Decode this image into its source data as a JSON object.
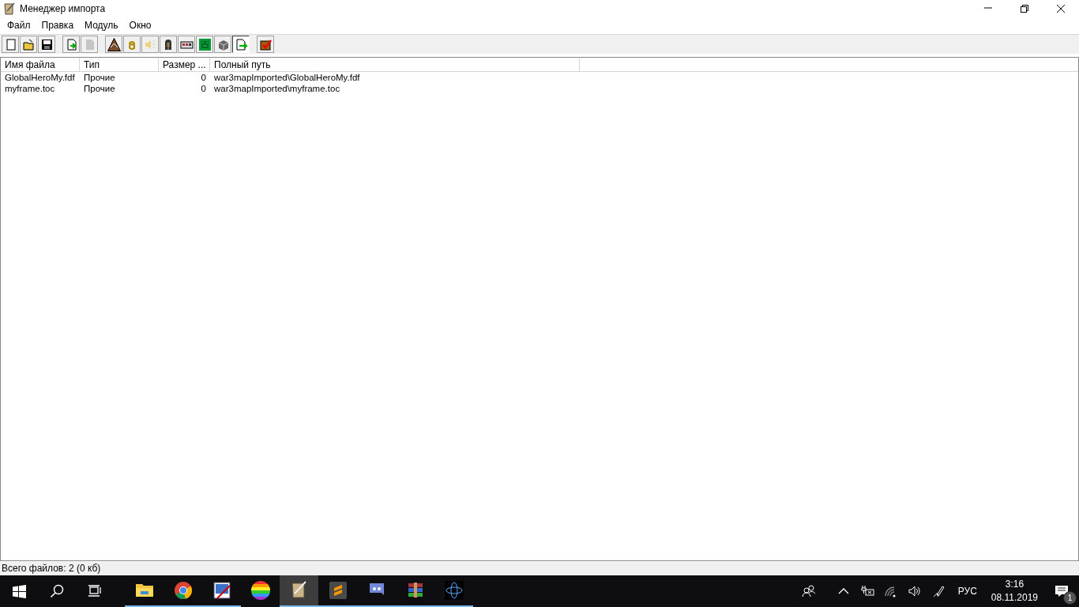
{
  "window": {
    "title": "Менеджер импорта"
  },
  "menu": [
    "Файл",
    "Правка",
    "Модуль",
    "Окно"
  ],
  "toolbar": [
    {
      "pressed": false,
      "disabled": false
    },
    {
      "pressed": false,
      "disabled": false
    },
    {
      "pressed": false,
      "disabled": false
    },
    {
      "pressed": false,
      "disabled": false
    },
    {
      "pressed": false,
      "disabled": true
    },
    {
      "pressed": false,
      "disabled": false
    },
    {
      "pressed": false,
      "disabled": false
    },
    {
      "pressed": false,
      "disabled": true
    },
    {
      "pressed": false,
      "disabled": false
    },
    {
      "pressed": false,
      "disabled": false
    },
    {
      "pressed": false,
      "disabled": false
    },
    {
      "pressed": false,
      "disabled": false
    },
    {
      "pressed": true,
      "disabled": false
    },
    {
      "pressed": false,
      "disabled": false
    }
  ],
  "table": {
    "columns": [
      "Имя файла",
      "Тип",
      "Размер ...",
      "Полный путь"
    ],
    "rows": [
      [
        "GlobalHeroMy.fdf",
        "Прочие",
        "0",
        "war3mapImported\\GlobalHeroMy.fdf"
      ],
      [
        "myframe.toc",
        "Прочие",
        "0",
        "war3mapImported\\myframe.toc"
      ]
    ]
  },
  "status_bar": "Всего файлов: 2 (0 кб)",
  "taskbar": {
    "apps": [
      {
        "running": true,
        "selected": false
      },
      {
        "running": true,
        "selected": false
      },
      {
        "running": true,
        "selected": false
      },
      {
        "running": false,
        "selected": false
      },
      {
        "running": true,
        "selected": true
      },
      {
        "running": true,
        "selected": false
      },
      {
        "running": true,
        "selected": false
      },
      {
        "running": true,
        "selected": false
      },
      {
        "running": true,
        "selected": false
      }
    ],
    "language": "РУС",
    "time": "3:16",
    "date": "08.11.2019",
    "notification_count": "1"
  }
}
